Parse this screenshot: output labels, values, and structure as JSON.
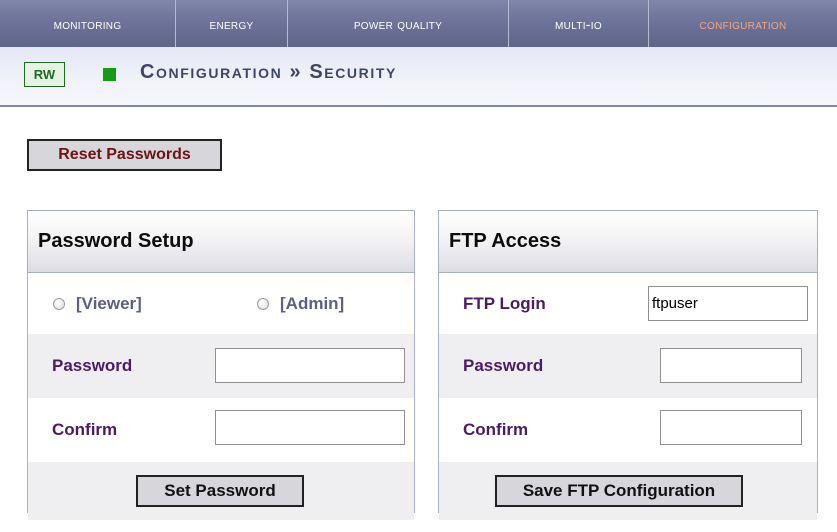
{
  "nav": {
    "tabs": [
      {
        "label": "Monitoring"
      },
      {
        "label": "Energy"
      },
      {
        "label": "Power Quality"
      },
      {
        "label": "Multi-IO"
      },
      {
        "label": "Configuration"
      }
    ],
    "active_tab": "Configuration"
  },
  "title_bar": {
    "badge": "RW",
    "title": "Configuration » Security"
  },
  "actions": {
    "reset_passwords": "Reset Passwords"
  },
  "password_setup": {
    "title": "Password Setup",
    "radio_viewer": "[Viewer]",
    "radio_admin": "[Admin]",
    "password_label": "Password",
    "password_value": "",
    "confirm_label": "Confirm",
    "confirm_value": "",
    "submit_label": "Set Password"
  },
  "ftp_access": {
    "title": "FTP Access",
    "login_label": "FTP Login",
    "login_value": "ftpuser",
    "password_label": "Password",
    "password_value": "",
    "confirm_label": "Confirm",
    "confirm_value": "",
    "submit_label": "Save FTP Configuration"
  },
  "colors": {
    "nav_bg": "#6e7499",
    "nav_active_text": "#f2a77f",
    "label_purple": "#4c1b68",
    "reset_text": "#6e1212",
    "status_green": "#169b16"
  }
}
